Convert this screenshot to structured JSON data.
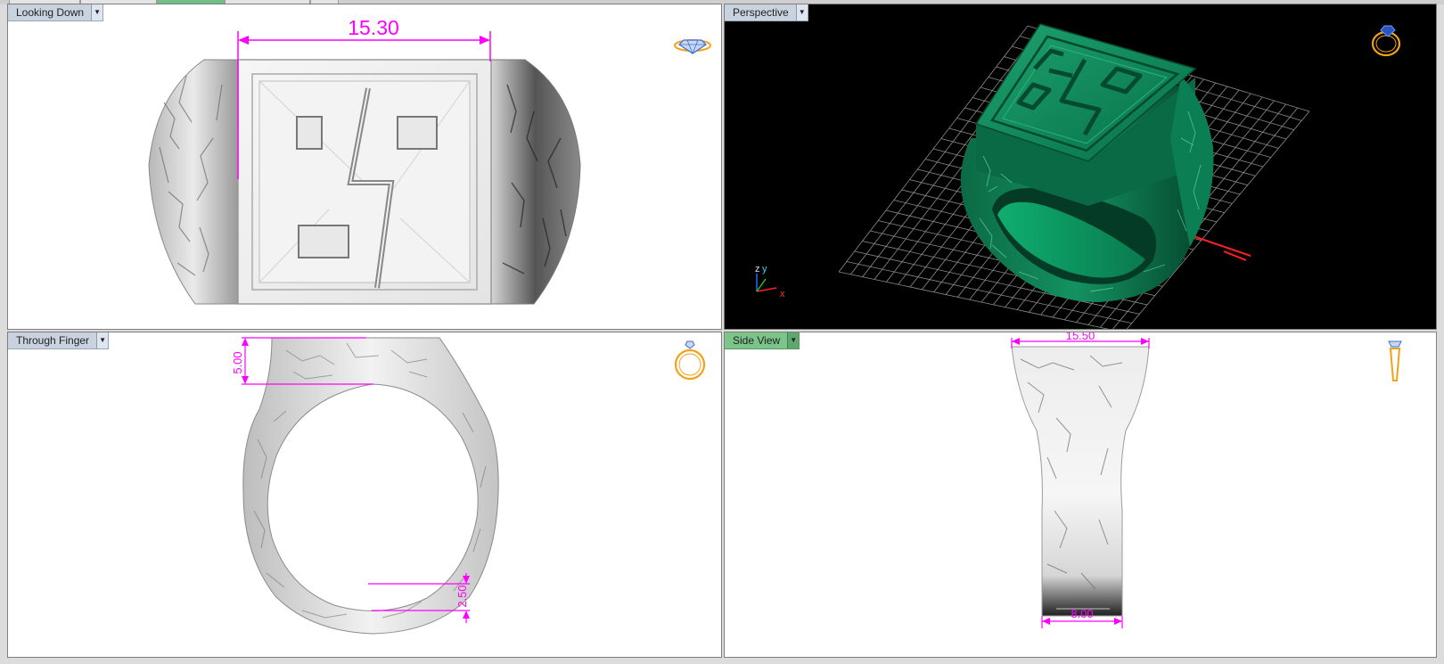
{
  "viewports": {
    "top_left": {
      "title": "Looking Down",
      "dimension": "15.30"
    },
    "top_right": {
      "title": "Perspective",
      "axis_z": "z",
      "axis_y": "y",
      "axis_x": "x"
    },
    "bottom_left": {
      "title": "Through Finger",
      "dim_top": "5.00",
      "dim_bottom": "2.50"
    },
    "bottom_right": {
      "title": "Side View",
      "dim_top": "15.50",
      "dim_bottom": "8.00"
    }
  },
  "icons": {
    "looking_down": "ring-top-view-icon",
    "perspective": "ring-perspective-icon",
    "through_finger": "ring-front-view-icon",
    "side_view": "ring-side-view-icon"
  },
  "colors": {
    "dimension": "#ff00ff",
    "model_green": "#0a7a52",
    "active_tab": "#7bc58a",
    "icon_orange": "#f4a11a",
    "icon_blue": "#3d6fd1",
    "x_axis": "#ff2020"
  }
}
